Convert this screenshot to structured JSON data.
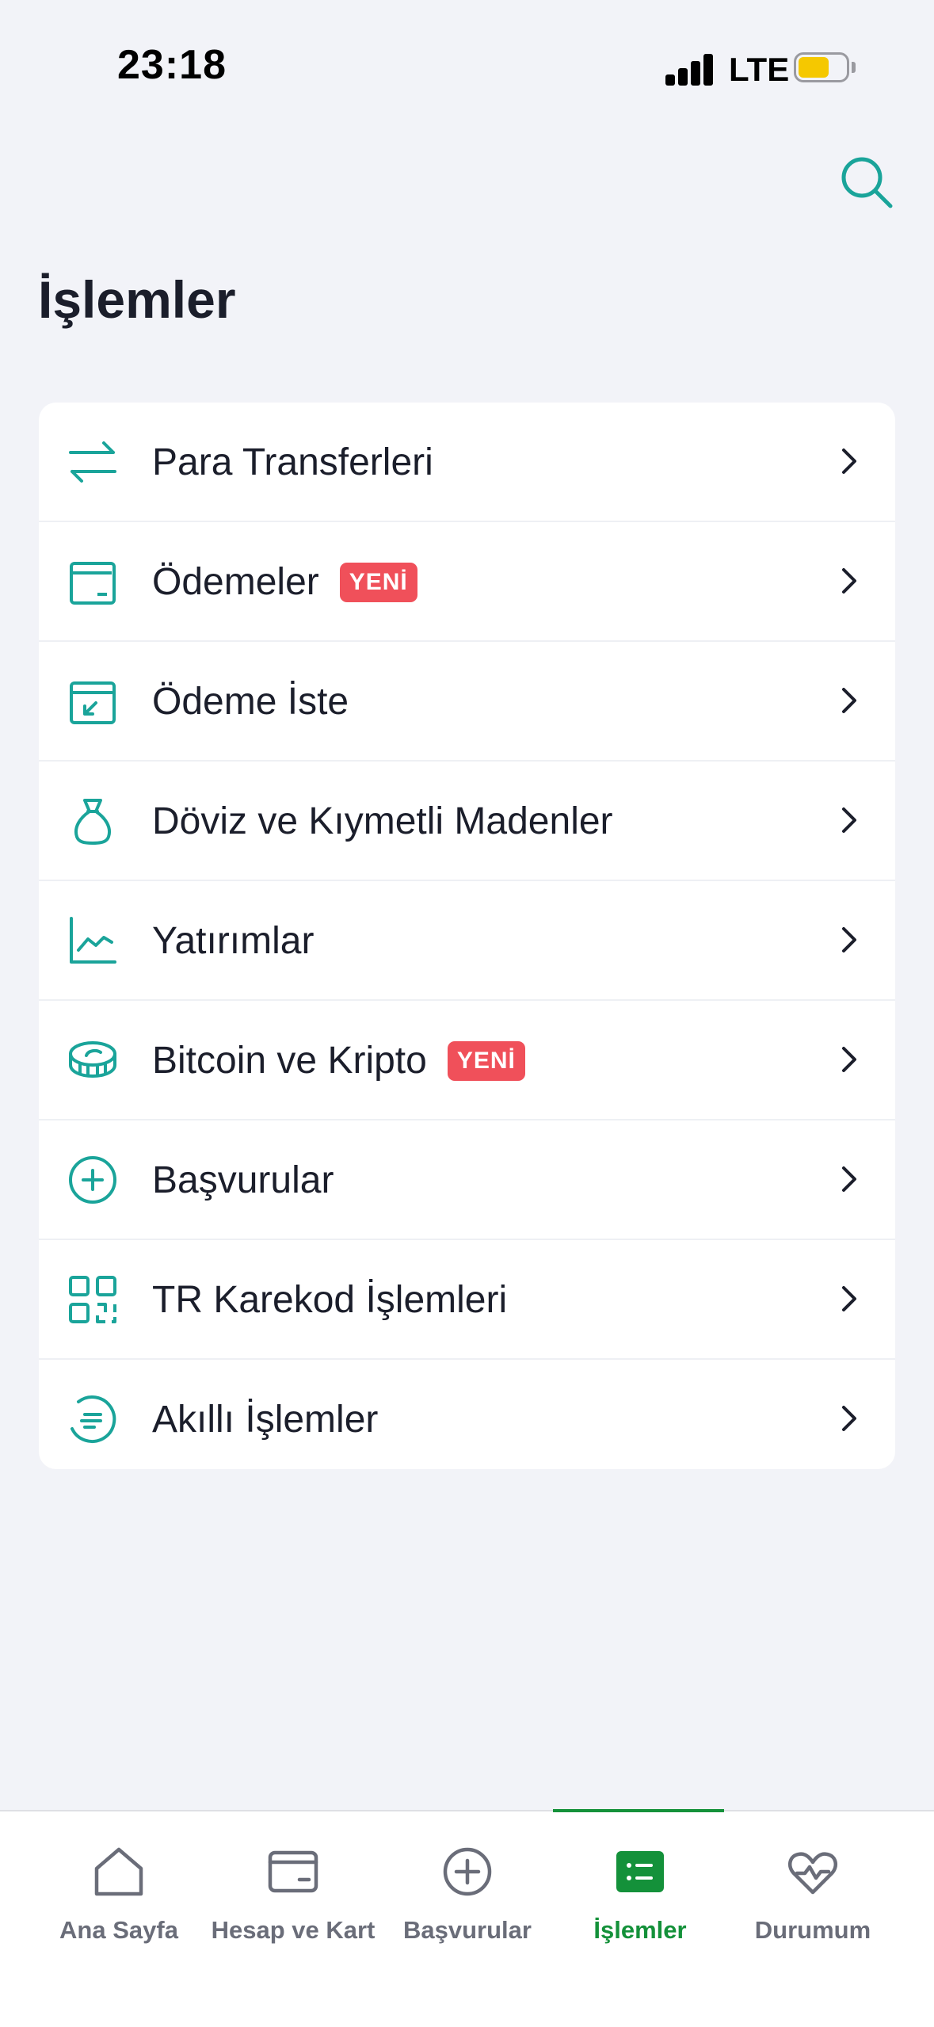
{
  "status_bar": {
    "time": "23:18",
    "carrier": "LTE"
  },
  "page": {
    "title": "İşlemler"
  },
  "menu": {
    "items": [
      {
        "label": "Para Transferleri",
        "icon": "transfer-arrows-icon"
      },
      {
        "label": "Ödemeler",
        "badge": "YENİ",
        "icon": "wallet-icon"
      },
      {
        "label": "Ödeme İste",
        "icon": "request-payment-icon"
      },
      {
        "label": "Döviz ve Kıymetli Madenler",
        "icon": "money-bag-icon"
      },
      {
        "label": "Yatırımlar",
        "icon": "line-chart-icon"
      },
      {
        "label": "Bitcoin ve Kripto",
        "badge": "YENİ",
        "icon": "coin-icon"
      },
      {
        "label": "Başvurular",
        "icon": "plus-circle-icon"
      },
      {
        "label": "TR Karekod İşlemleri",
        "icon": "qr-code-icon"
      },
      {
        "label": "Akıllı İşlemler",
        "icon": "smart-operations-icon"
      }
    ]
  },
  "tab_bar": {
    "tabs": [
      {
        "label": "Ana Sayfa",
        "icon": "home-icon"
      },
      {
        "label": "Hesap ve Kart",
        "icon": "card-icon"
      },
      {
        "label": "Başvurular",
        "icon": "plus-circle-icon"
      },
      {
        "label": "İşlemler",
        "icon": "list-icon",
        "active": true
      },
      {
        "label": "Durumum",
        "icon": "heart-pulse-icon"
      }
    ]
  },
  "colors": {
    "accent_teal": "#1aa49a",
    "active_green": "#14913a",
    "badge_red": "#f0505a",
    "background": "#f2f3f8"
  }
}
